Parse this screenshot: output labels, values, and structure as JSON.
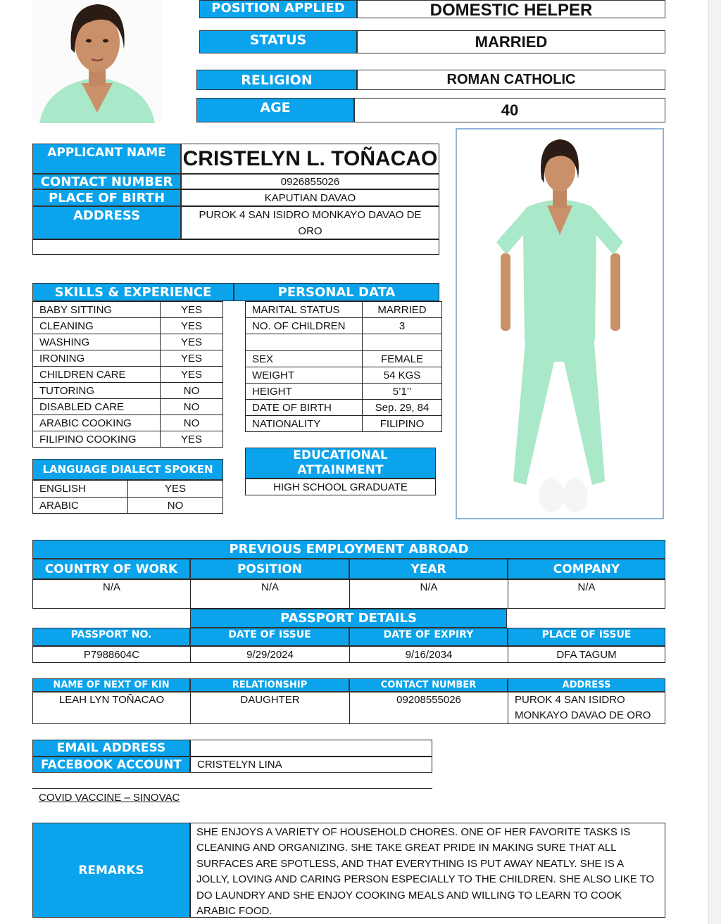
{
  "header": {
    "position_applied_label": "POSITION APPLIED",
    "position_applied_value": "DOMESTIC HELPER",
    "status_label": "STATUS",
    "status_value": "MARRIED",
    "religion_label": "RELIGION",
    "religion_value": "ROMAN CATHOLIC",
    "age_label": "AGE",
    "age_value": "40"
  },
  "applicant": {
    "name_label": "APPLICANT NAME",
    "name_value": "CRISTELYN L. TOÑACAO",
    "contact_label": "CONTACT NUMBER",
    "contact_value": "0926855026",
    "birthplace_label": "PLACE OF BIRTH",
    "birthplace_value": "KAPUTIAN DAVAO",
    "address_label": "ADDRESS",
    "address_value": "PUROK 4 SAN ISIDRO MONKAYO DAVAO DE ORO"
  },
  "skills": {
    "title": "SKILLS & EXPERIENCE",
    "rows": [
      {
        "skill": "BABY SITTING",
        "value": "YES"
      },
      {
        "skill": "CLEANING",
        "value": "YES"
      },
      {
        "skill": "WASHING",
        "value": "YES"
      },
      {
        "skill": "IRONING",
        "value": "YES"
      },
      {
        "skill": "CHILDREN CARE",
        "value": "YES"
      },
      {
        "skill": "TUTORING",
        "value": "NO"
      },
      {
        "skill": "DISABLED CARE",
        "value": "NO"
      },
      {
        "skill": "ARABIC COOKING",
        "value": "NO"
      },
      {
        "skill": "FILIPINO COOKING",
        "value": "YES"
      }
    ]
  },
  "personal": {
    "title": "PERSONAL DATA",
    "rows": [
      {
        "label": "MARITAL STATUS",
        "value": "MARRIED"
      },
      {
        "label": "NO. OF CHILDREN",
        "value": "3"
      },
      {
        "label": "",
        "value": ""
      },
      {
        "label": "SEX",
        "value": "FEMALE"
      },
      {
        "label": "WEIGHT",
        "value": "54 KGS"
      },
      {
        "label": "HEIGHT",
        "value": "5’1’’"
      },
      {
        "label": "DATE OF BIRTH",
        "value": "Sep. 29, 84"
      },
      {
        "label": "NATIONALITY",
        "value": "FILIPINO"
      }
    ]
  },
  "language": {
    "title": "LANGUAGE DIALECT SPOKEN",
    "rows": [
      {
        "language": "ENGLISH",
        "value": "YES"
      },
      {
        "language": "ARABIC",
        "value": "NO"
      }
    ]
  },
  "education": {
    "title_line1": "EDUCATIONAL",
    "title_line2": "ATTAINMENT",
    "value": "HIGH SCHOOL GRADUATE"
  },
  "employment": {
    "title": "PREVIOUS EMPLOYMENT ABROAD",
    "headers": [
      "COUNTRY OF WORK",
      "POSITION",
      "YEAR",
      "COMPANY"
    ],
    "values": [
      "N/A",
      "N/A",
      "N/A",
      "N/A"
    ]
  },
  "passport": {
    "title": "PASSPORT DETAILS",
    "headers": [
      "PASSPORT NO.",
      "DATE OF ISSUE",
      "DATE OF EXPIRY",
      "PLACE OF ISSUE"
    ],
    "values": [
      "P7988604C",
      "9/29/2024",
      "9/16/2034",
      "DFA TAGUM"
    ]
  },
  "kin": {
    "headers": [
      "NAME OF NEXT OF KIN",
      "RELATIONSHIP",
      "CONTACT NUMBER",
      "ADDRESS"
    ],
    "values": [
      "LEAH LYN TOÑACAO",
      "DAUGHTER",
      "09208555026",
      "PUROK 4 SAN ISIDRO MONKAYO DAVAO DE ORO"
    ]
  },
  "contact": {
    "email_label": "EMAIL ADDRESS",
    "email_value": "",
    "facebook_label": "FACEBOOK ACCOUNT",
    "facebook_value": "CRISTELYN LINA"
  },
  "vaccine": "COVID VACCINE – SINOVAC",
  "remarks": {
    "label": "REMARKS",
    "text": "SHE ENJOYS A VARIETY OF HOUSEHOLD CHORES. ONE OF HER FAVORITE TASKS IS CLEANING AND ORGANIZING. SHE TAKE GREAT PRIDE IN MAKING SURE THAT ALL SURFACES ARE SPOTLESS, AND THAT EVERYTHING IS PUT AWAY NEATLY. SHE IS A JOLLY, LOVING AND CARING PERSON ESPECIALLY TO THE CHILDREN. SHE ALSO LIKE TO DO LAUNDRY AND SHE ENJOY COOKING MEALS AND WILLING TO LEARN TO COOK ARABIC FOOD."
  },
  "colors": {
    "accent": "#0aa3ec",
    "uniform": "#a9e8c8",
    "skin": "#c9906a",
    "hair": "#2a1c14"
  }
}
